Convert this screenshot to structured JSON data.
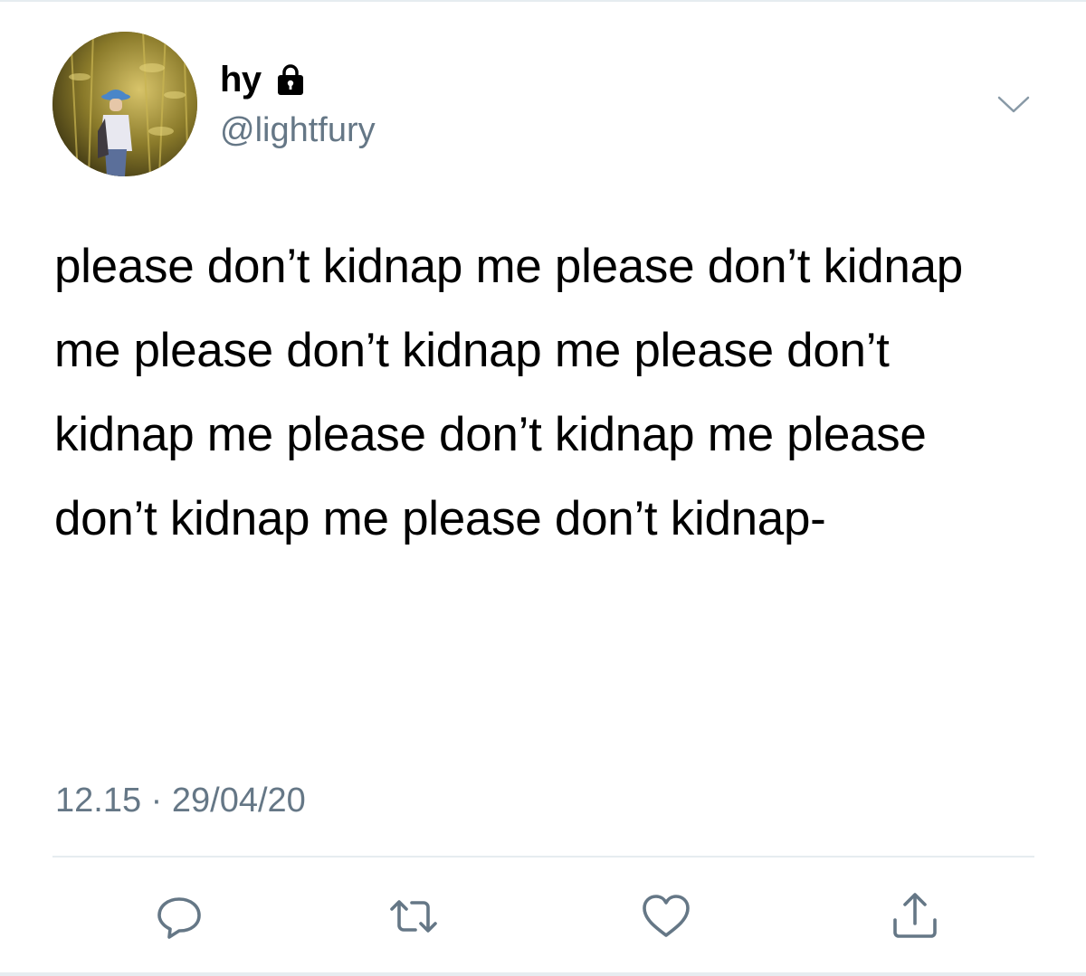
{
  "tweet": {
    "author": {
      "display_name": "hy",
      "handle": "@lightfury",
      "avatar_icon": "profile-photo",
      "protected_icon": "lock-icon"
    },
    "menu_icon": "chevron-down-icon",
    "text": "please don’t kidnap me please don’t kidnap me please don’t kidnap me please don’t kidnap me please don’t kidnap me please don’t kidnap me please don’t kidnap-",
    "timestamp": "12.15 · 29/04/20"
  },
  "actions": [
    {
      "name": "reply",
      "icon": "speech-bubble-icon"
    },
    {
      "name": "retweet",
      "icon": "retweet-icon"
    },
    {
      "name": "like",
      "icon": "heart-icon"
    },
    {
      "name": "share",
      "icon": "share-icon"
    }
  ],
  "colors": {
    "text": "#000000",
    "secondary": "#657786",
    "icon": "#657786",
    "divider": "#e6ecf0"
  }
}
